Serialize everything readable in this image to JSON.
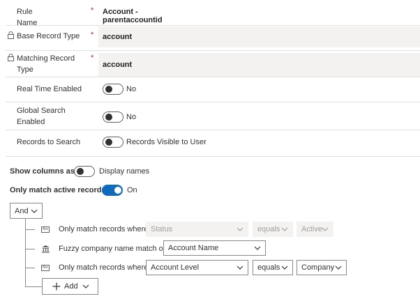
{
  "fields": {
    "rule_name": {
      "label": "Rule Name",
      "required": "*",
      "value": "Account - parentaccountid"
    },
    "base_record_type": {
      "label": "Base Record Type",
      "required": "*",
      "value": "account"
    },
    "matching_record_type": {
      "label_line1": "Matching Record",
      "label_line2": "Type",
      "required": "*",
      "value": "account"
    },
    "real_time_enabled": {
      "label": "Real Time Enabled",
      "value": "No"
    },
    "global_search_enabled": {
      "label_line1": "Global Search",
      "label_line2": "Enabled",
      "value": "No"
    },
    "records_to_search": {
      "label": "Records to Search",
      "value": "Records Visible to User"
    }
  },
  "options": {
    "show_columns_as": {
      "label": "Show columns as",
      "value": "Display names"
    },
    "only_match_active": {
      "label": "Only match active records",
      "value": "On"
    }
  },
  "group": {
    "operator": "And"
  },
  "conditions": [
    {
      "icon": "abc-text-icon",
      "icon_text": "Abc",
      "text": "Only match records where",
      "field": "Status",
      "operator": "equals",
      "value": "Active",
      "disabled": true
    },
    {
      "icon": "bank-building-icon",
      "text": "Fuzzy company name match on",
      "field": "Account Name"
    },
    {
      "icon": "abc-text-icon",
      "icon_text": "Abc",
      "text": "Only match records where",
      "field": "Account Level",
      "operator": "equals",
      "value": "Company",
      "disabled": false
    }
  ],
  "add_button": {
    "label": "Add"
  },
  "colors": {
    "accent": "#0f6cbd",
    "required": "#a4262c",
    "field_bg": "#f3f2f1",
    "divider": "#e1dfdd"
  }
}
